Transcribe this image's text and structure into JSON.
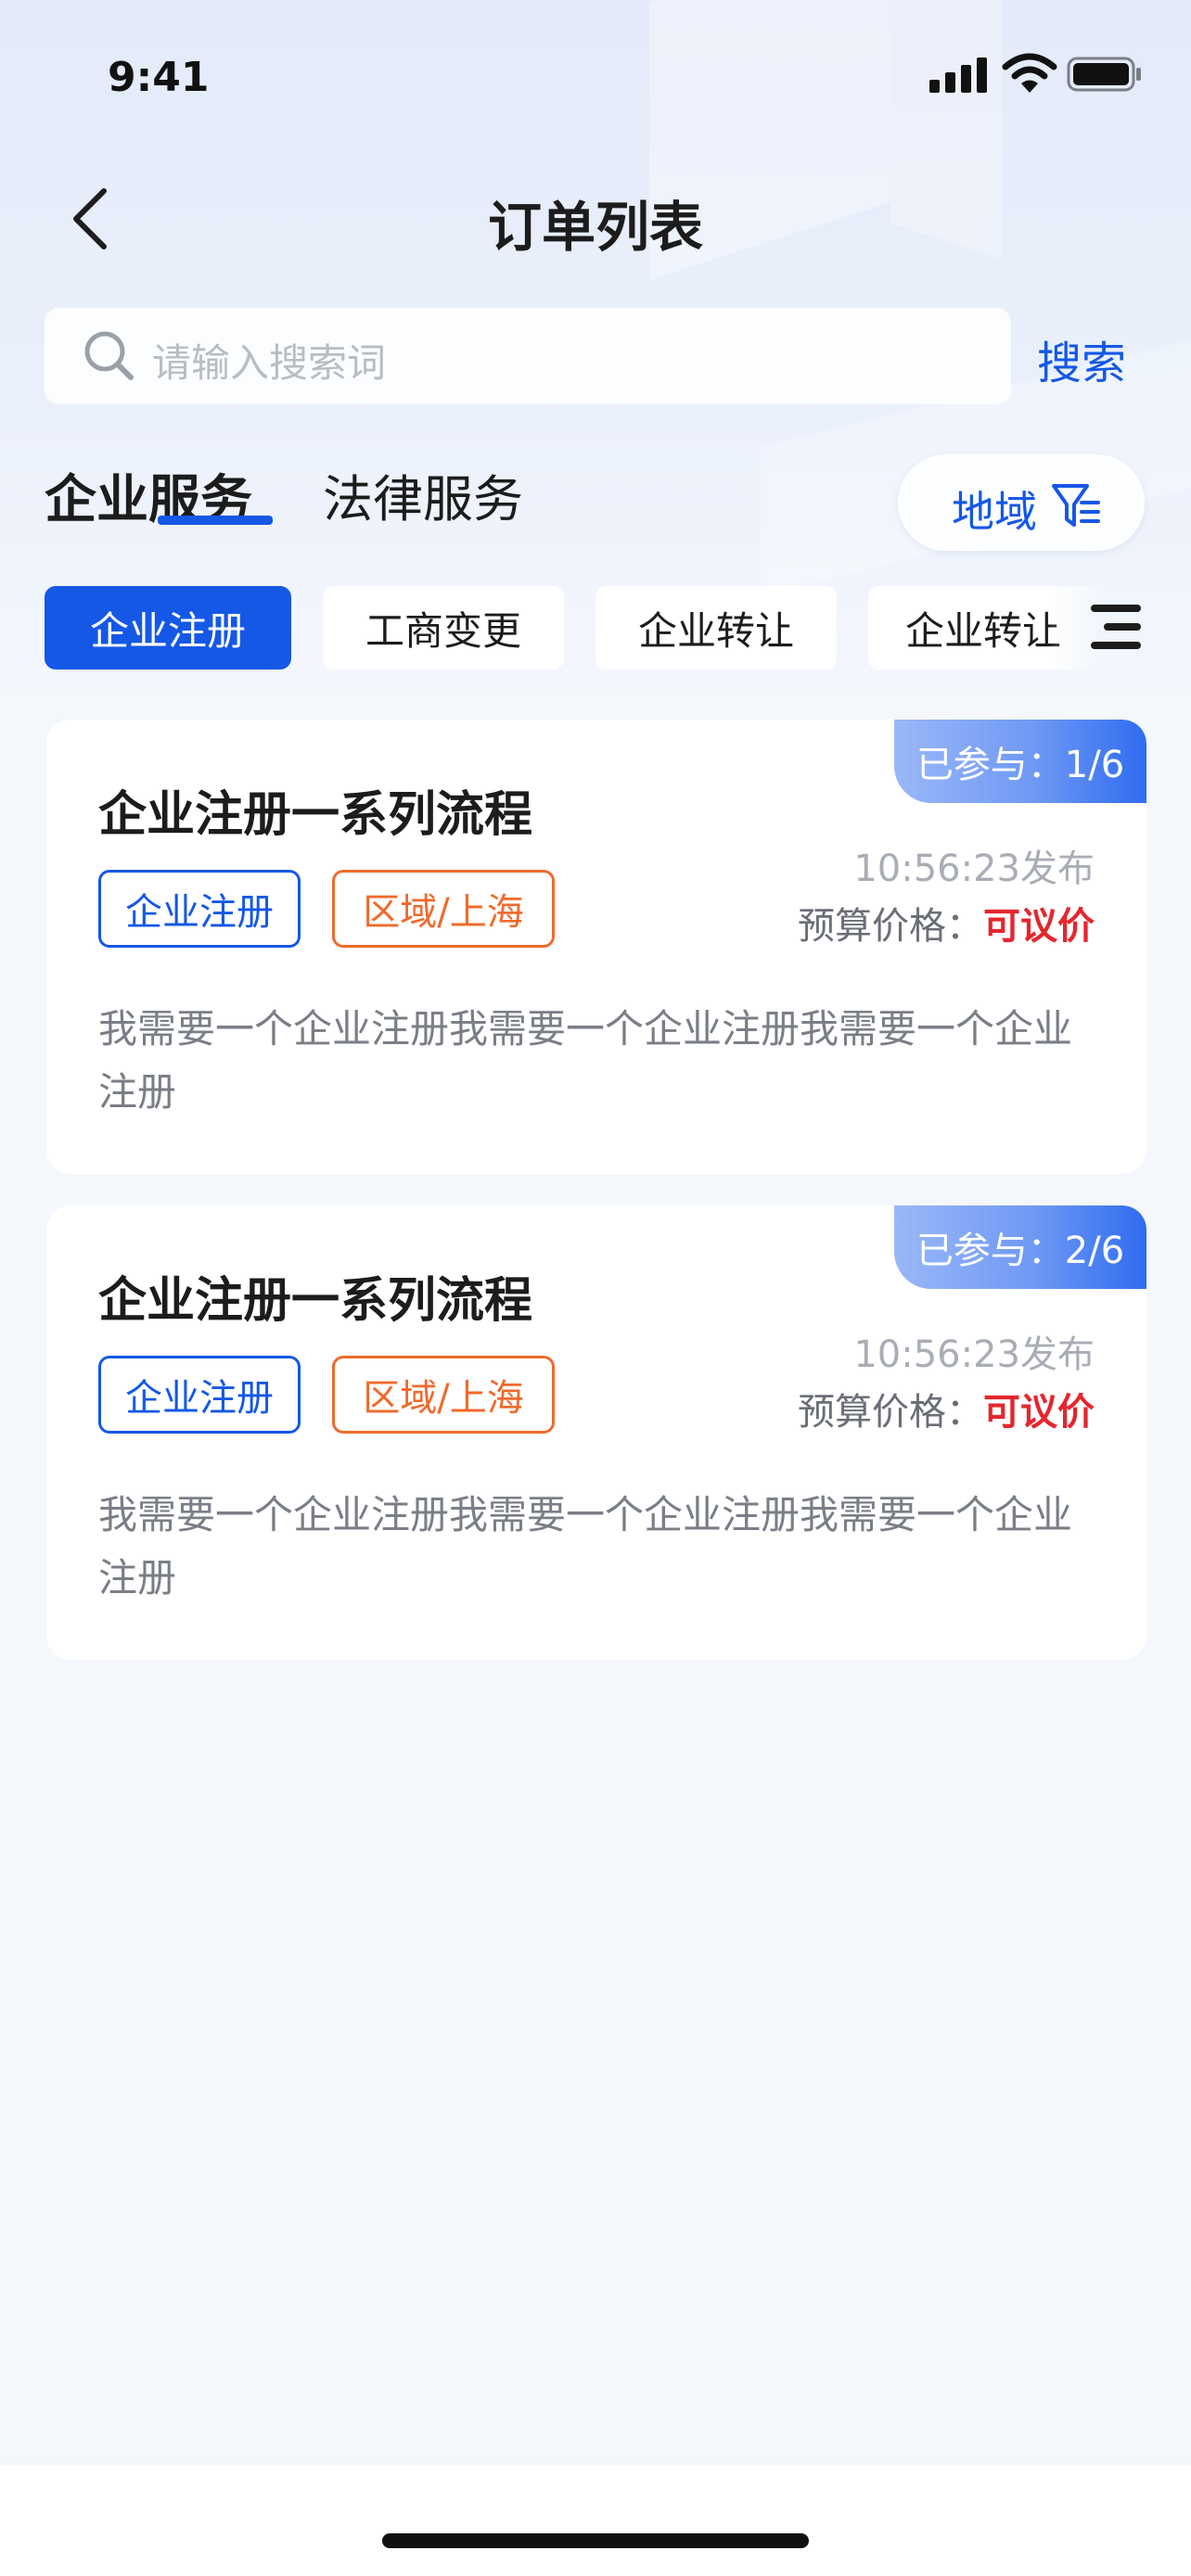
{
  "status_bar": {
    "time": "9:41"
  },
  "nav": {
    "title": "订单列表"
  },
  "search": {
    "placeholder": "请输入搜索词",
    "button_label": "搜索"
  },
  "category_tabs": [
    {
      "label": "企业服务",
      "active": true
    },
    {
      "label": "法律服务",
      "active": false
    }
  ],
  "region_filter": {
    "label": "地域"
  },
  "chips": [
    {
      "label": "企业注册",
      "active": true
    },
    {
      "label": "工商变更",
      "active": false
    },
    {
      "label": "企业转让",
      "active": false
    },
    {
      "label": "企业转让",
      "active": false
    }
  ],
  "orders": [
    {
      "join": "已参与：1/6",
      "title": "企业注册一系列流程",
      "tag_service": "企业注册",
      "tag_region": "区域/上海",
      "publish_time": "10:56:23发布",
      "budget_label": "预算价格：",
      "budget_value": "可议价",
      "description": "我需要一个企业注册我需要一个企业注册我需要一个企业注册"
    },
    {
      "join": "已参与：2/6",
      "title": "企业注册一系列流程",
      "tag_service": "企业注册",
      "tag_region": "区域/上海",
      "publish_time": "10:56:23发布",
      "budget_label": "预算价格：",
      "budget_value": "可议价",
      "description": "我需要一个企业注册我需要一个企业注册我需要一个企业注册"
    }
  ],
  "colors": {
    "accent": "#1558e6",
    "price": "#e5262f",
    "tag_orange": "#f06a2c"
  },
  "icons": [
    "back-arrow-icon",
    "search-icon",
    "filter-icon",
    "menu-icon",
    "signal-icon",
    "wifi-icon",
    "battery-icon"
  ]
}
